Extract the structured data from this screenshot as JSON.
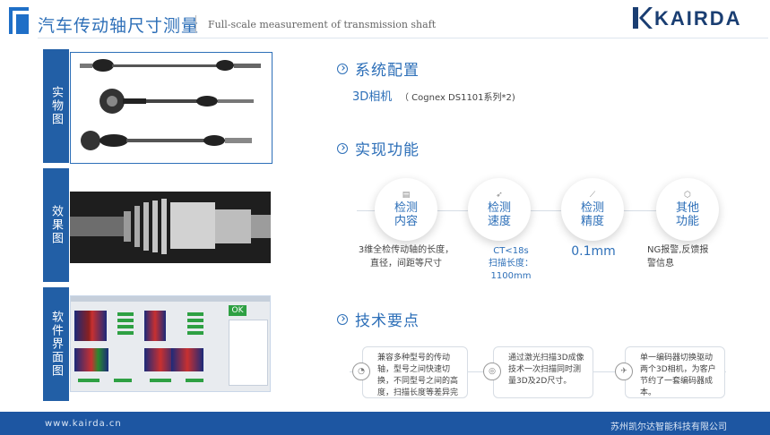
{
  "header": {
    "title": "汽车传动轴尺寸测量",
    "subtitle": "Full-scale measurement of transmission shaft",
    "logo_text": "KAIRDA"
  },
  "side": {
    "tab1": "实物图",
    "tab2": "效果图",
    "tab3": "软件界面图"
  },
  "software_ui": {
    "ok_label": "OK"
  },
  "config": {
    "title": "系统配置",
    "camera": "3D相机",
    "camera_detail": "（ Cognex DS1101系列*2)"
  },
  "functions": {
    "title": "实现功能",
    "items": [
      {
        "label": "检测内容",
        "icon": "document-icon"
      },
      {
        "label": "检测速度",
        "icon": "rocket-icon"
      },
      {
        "label": "检测精度",
        "icon": "ruler-icon"
      },
      {
        "label": "其他功能",
        "icon": "cube-icon"
      }
    ],
    "content_desc_1": "3维全检传动轴的长度，",
    "content_desc_2": "直径，间距等尺寸",
    "speed_ct": "CT<18s",
    "speed_scan_label": "扫描长度：",
    "speed_scan_value": "1100mm",
    "precision": "0.1mm",
    "other_1": "NG报警,反馈报",
    "other_2": "警信息"
  },
  "tech": {
    "title": "技术要点",
    "points": [
      "兼容多种型号的传动轴，型号之间快速切换，不同型号之间的高度，扫描长度等差异完美兼容。",
      "通过激光扫描3D成像技术一次扫描同时测量3D及2D尺寸。",
      "单一编码器切换驱动两个3D相机，为客户节约了一套编码器成本。"
    ]
  },
  "footer": {
    "website": "www.kairda.cn",
    "company": "苏州凯尔达智能科技有限公司"
  },
  "colors": {
    "primary": "#2d6fb8",
    "dark_blue": "#1d56a2",
    "logo": "#1a3e72"
  }
}
